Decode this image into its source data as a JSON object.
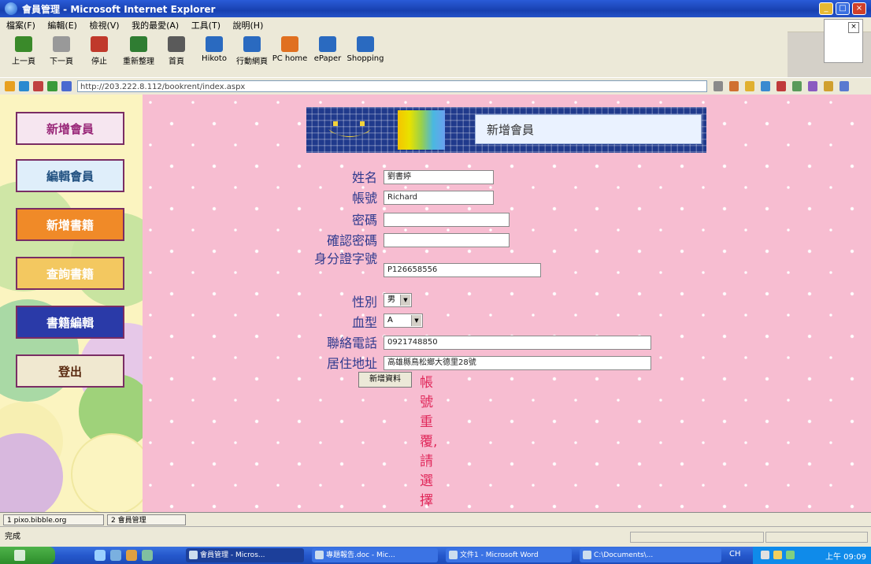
{
  "window": {
    "title": "會員管理 - Microsoft Internet Explorer"
  },
  "menu": [
    "檔案(F)",
    "編輯(E)",
    "檢視(V)",
    "我的最愛(A)",
    "工具(T)",
    "說明(H)"
  ],
  "toolbar": [
    {
      "label": "上一頁",
      "icon": "back-icon",
      "color": "#3a8a2a"
    },
    {
      "label": "下一頁",
      "icon": "forward-icon",
      "color": "#999999"
    },
    {
      "label": "停止",
      "icon": "stop-icon",
      "color": "#c0392b"
    },
    {
      "label": "重新整理",
      "icon": "refresh-icon",
      "color": "#2f7d32"
    },
    {
      "label": "首頁",
      "icon": "home-icon",
      "color": "#5a5a5a"
    },
    {
      "label": "Hikoto",
      "icon": "globe-icon",
      "color": "#2a6ac0"
    },
    {
      "label": "行動網頁",
      "icon": "mobile-icon",
      "color": "#2a6ac0"
    },
    {
      "label": "PC home",
      "icon": "pchome-icon",
      "color": "#e07020"
    },
    {
      "label": "ePaper",
      "icon": "epaper-icon",
      "color": "#2a6ac0"
    },
    {
      "label": "Shopping",
      "icon": "shopping-icon",
      "color": "#2a6ac0"
    }
  ],
  "address": {
    "url": "http://203.222.8.112/bookrent/index.aspx"
  },
  "nav": [
    {
      "label": "新增會員",
      "bg": "#f6e6f0",
      "fg": "#9a2a7a"
    },
    {
      "label": "編輯會員",
      "bg": "#dfeefa",
      "fg": "#205080"
    },
    {
      "label": "新增書籍",
      "bg": "#f08a28",
      "fg": "#ffffff"
    },
    {
      "label": "查詢書籍",
      "bg": "#f3c860",
      "fg": "#ffffff"
    },
    {
      "label": "書籍編輯",
      "bg": "#2a3aa8",
      "fg": "#ffffff"
    },
    {
      "label": "登出",
      "bg": "#f0e8d0",
      "fg": "#5a2a10"
    }
  ],
  "banner": {
    "title": "新增會員"
  },
  "form": {
    "fields": [
      {
        "label": "姓名",
        "value": "劉書婷"
      },
      {
        "label": "帳號",
        "value": "Richard"
      },
      {
        "label": "密碼",
        "value": ""
      },
      {
        "label": "確認密碼",
        "value": ""
      },
      {
        "label": "身分證字號",
        "value": "P126658556"
      },
      {
        "label": "性別",
        "value": "男"
      },
      {
        "label": "血型",
        "value": "A"
      },
      {
        "label": "聯絡電話",
        "value": "0921748850"
      },
      {
        "label": "居住地址",
        "value": "高雄縣鳥松鄉大德里28號"
      }
    ],
    "submit_label": "新增資料",
    "error": "帳號重覆,請選擇其他帳號!"
  },
  "frame_tabs": [
    "1 pixo.bibble.org",
    "2 會員管理"
  ],
  "status": {
    "text": "完成"
  },
  "taskbar": {
    "tasks": [
      {
        "label": "會員管理 - Micros...",
        "active": true
      },
      {
        "label": "專題報告.doc - Mic...",
        "active": false
      },
      {
        "label": "文件1 - Microsoft Word",
        "active": false
      },
      {
        "label": "C:\\Documents\\...",
        "active": false
      }
    ],
    "lang": "CH",
    "clock": "上午 09:09"
  }
}
